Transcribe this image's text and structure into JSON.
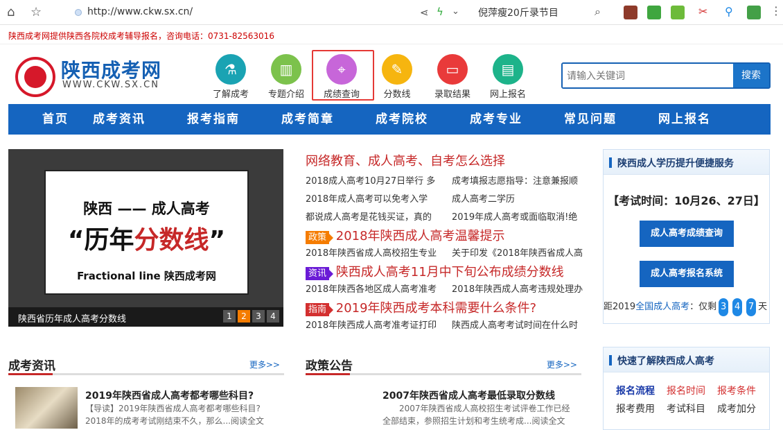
{
  "browser": {
    "url": "http://www.ckw.sx.cn/",
    "search_hint": "倪萍瘦20斤录节目"
  },
  "notice": "陕西成考网提供陕西各院校成考辅导报名，咨询电话：0731-82563016",
  "logo": {
    "title": "陕西成考网",
    "subtitle": "WWW.CKW.SX.CN"
  },
  "quick_nav": [
    {
      "label": "了解成考",
      "color": "#1aa3b3",
      "icon": "flask-icon"
    },
    {
      "label": "专题介绍",
      "color": "#7cc24c",
      "icon": "building-icon"
    },
    {
      "label": "成绩查询",
      "color": "#c766d9",
      "icon": "telescope-icon"
    },
    {
      "label": "分数线",
      "color": "#f6b50f",
      "icon": "pen-icon"
    },
    {
      "label": "录取结果",
      "color": "#e93a3a",
      "icon": "laptop-icon"
    },
    {
      "label": "网上报名",
      "color": "#1db38a",
      "icon": "clipboard-icon"
    }
  ],
  "search": {
    "placeholder": "请输入关键词",
    "button": "搜索"
  },
  "main_nav": [
    "首页",
    "成考资讯",
    "报考指南",
    "成考简章",
    "成考院校",
    "成考专业",
    "常见问题",
    "网上报名"
  ],
  "banner": {
    "line1": "陕西 —— 成人高考",
    "line2_a": "“历年",
    "line2_b": "分数线",
    "line2_c": "”",
    "line3": "Fractional line  陕西成考网",
    "caption": "陕西省历年成人高考分数线",
    "pages": [
      "1",
      "2",
      "3",
      "4"
    ],
    "active_page": 2
  },
  "news": {
    "headline": "网络教育、成人高考、自考怎么选择",
    "rows1": [
      [
        "2018成人高考10月27日举行 多",
        "成考填报志愿指导：注意兼报顺"
      ],
      [
        "2018年成人高考可以免考入学",
        "成人高考二学历"
      ],
      [
        "都说成人高考是花钱买证，真的",
        "2019年成人高考或面临取消!绝"
      ]
    ],
    "tag1": "政策",
    "head2": "2018年陕西成人高考温馨提示",
    "row2": [
      "2018年陕西省成人高校招生专业",
      "关于印发《2018年陕西省成人高"
    ],
    "tag2": "资讯",
    "head3": "陕西成人高考11月中下旬公布成绩分数线",
    "row3": [
      "2018年陕西各地区成人高考准考",
      "2018年陕西成人高考违规处理办"
    ],
    "tag3": "指南",
    "head4": "2019年陕西成考本科需要什么条件?",
    "row4": [
      "2018年陕西成人高考准考证打印",
      "陕西成人高考考试时间在什么时"
    ]
  },
  "service_panel": {
    "title": "陕西成人学历提升便捷服务",
    "exam_time": "【考试时间：10月26、27日】",
    "btn1": "成人高考成绩查询",
    "btn2": "成人高考报名系统",
    "cd_prefix": "距2019",
    "cd_blue": "全国成人高考",
    "cd_mid": "：仅剩",
    "cd_digits": [
      "3",
      "4",
      "7"
    ],
    "cd_suffix": "天"
  },
  "quick_panel": {
    "title": "快速了解陕西成人高考",
    "row1": [
      "报名流程",
      "报名时间",
      "报考条件"
    ],
    "row2": [
      "报考费用",
      "考试科目",
      "成考加分"
    ]
  },
  "sections": {
    "left": {
      "title": "成考资讯",
      "more": "更多>>",
      "art_title": "2019年陕西省成人高考都考哪些科目?",
      "art_desc": "【导读】2019年陕西省成人高考都考哪些科目?2018年的成考考试刚结束不久，那么...阅读全文"
    },
    "mid": {
      "title": "政策公告",
      "more": "更多>>",
      "art_title": "2007年陕西省成人高考最低录取分数线",
      "art_desc": "2007年陕西省成人高校招生考试评卷工作已经全部结束，参照招生计划和考生统考成...阅读全文"
    }
  }
}
